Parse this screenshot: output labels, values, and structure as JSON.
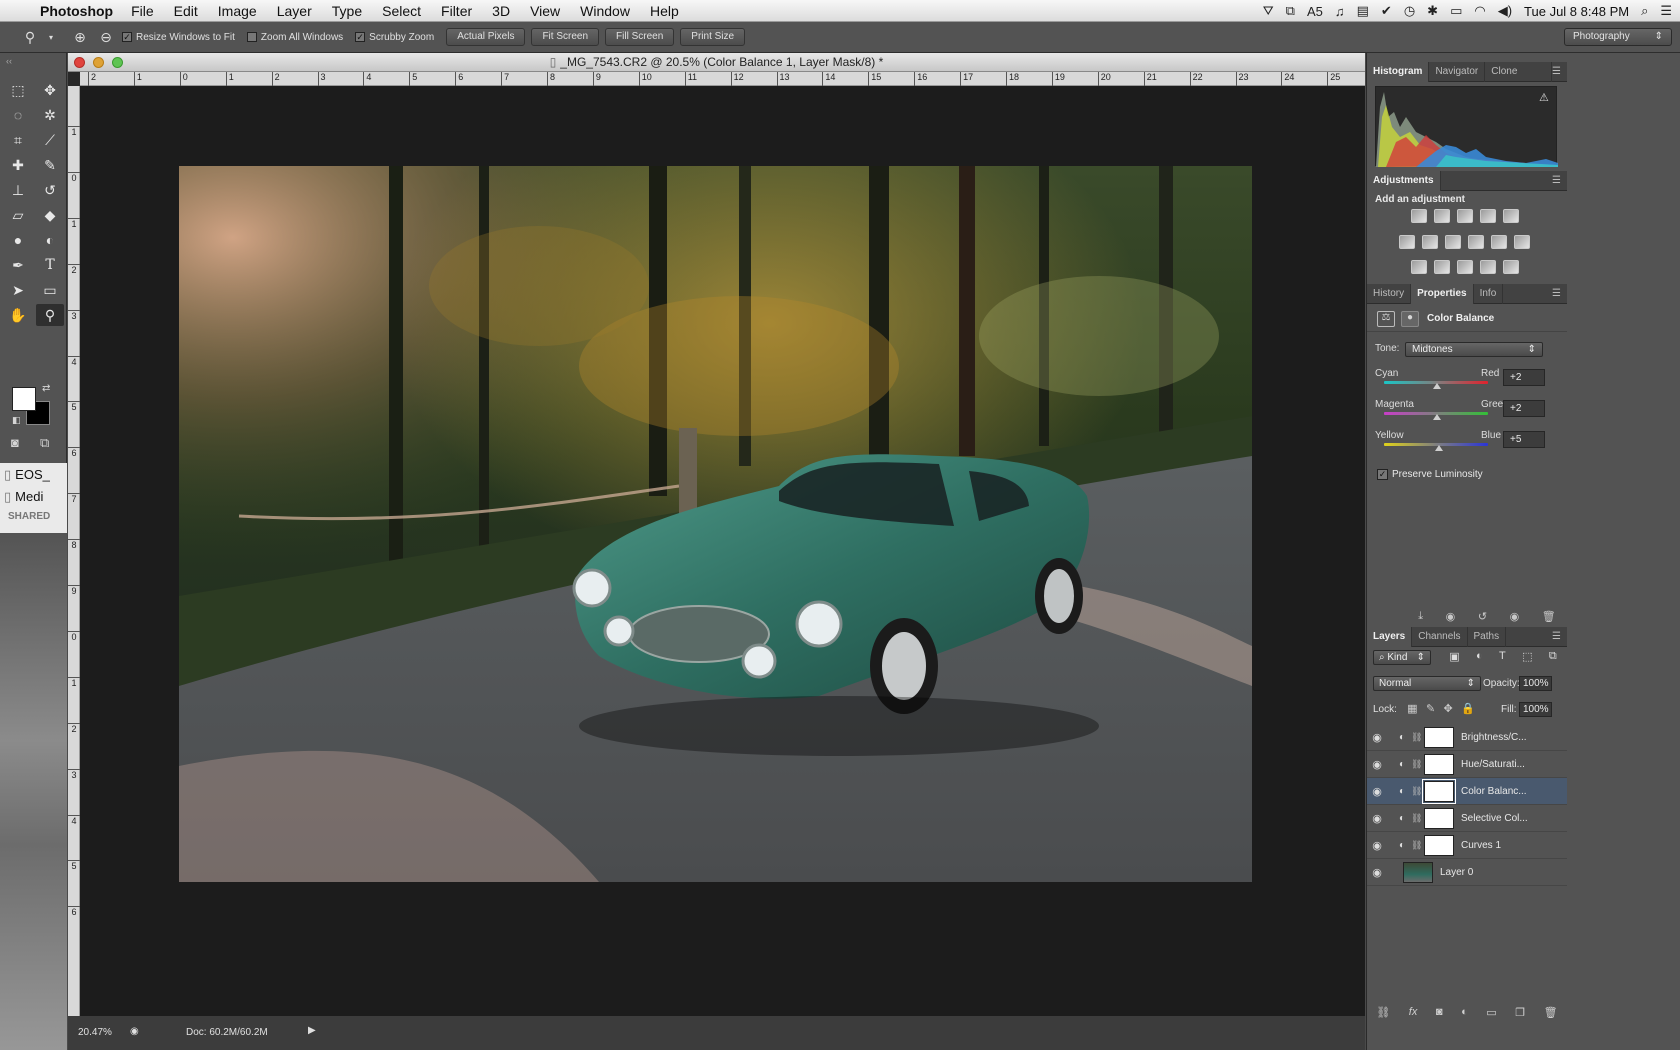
{
  "menubar": {
    "app_name": "Photoshop",
    "menus": [
      "File",
      "Edit",
      "Image",
      "Layer",
      "Type",
      "Select",
      "Filter",
      "3D",
      "View",
      "Window",
      "Help"
    ],
    "status_count": "5",
    "clock": "Tue Jul 8  8:48 PM"
  },
  "options": {
    "resize_windows": "Resize Windows to Fit",
    "zoom_all": "Zoom All Windows",
    "scrubby": "Scrubby Zoom",
    "actual_pixels": "Actual Pixels",
    "fit_screen": "Fit Screen",
    "fill_screen": "Fill Screen",
    "print_size": "Print Size",
    "workspace": "Photography"
  },
  "document": {
    "title": "_MG_7543.CR2 @ 20.5% (Color Balance 1, Layer Mask/8) *",
    "ruler_h": [
      "2",
      "1",
      "0",
      "1",
      "2",
      "3",
      "4",
      "5",
      "6",
      "7",
      "8",
      "9",
      "10",
      "11",
      "12",
      "13",
      "14",
      "15",
      "16",
      "17",
      "18",
      "19",
      "20",
      "21",
      "22",
      "23",
      "24",
      "25"
    ],
    "ruler_v": [
      "1",
      "0",
      "1",
      "2",
      "3",
      "4",
      "5",
      "6",
      "7",
      "8",
      "9",
      "0",
      "1",
      "2",
      "3",
      "4",
      "5",
      "6"
    ],
    "zoom": "20.47%",
    "doc_size": "Doc: 60.2M/60.2M"
  },
  "sidebar_files": {
    "item1": "EOS_",
    "item2": "Medi",
    "shared": "SHARED"
  },
  "panels": {
    "top_tabs": [
      "Histogram",
      "Navigator",
      "Clone Sourc"
    ],
    "adjustments_tab": "Adjustments",
    "add_adjustment": "Add an adjustment",
    "prop_tabs": [
      "History",
      "Properties",
      "Info"
    ],
    "prop_title": "Color Balance",
    "tone_label": "Tone:",
    "tone_value": "Midtones",
    "sliders": [
      {
        "left": "Cyan",
        "right": "Red",
        "value": "+2",
        "level": 0.51
      },
      {
        "left": "Magenta",
        "right": "Green",
        "value": "+2",
        "level": 0.51
      },
      {
        "left": "Yellow",
        "right": "Blue",
        "value": "+5",
        "level": 0.525
      }
    ],
    "preserve": "Preserve Luminosity",
    "layer_tabs": [
      "Layers",
      "Channels",
      "Paths"
    ],
    "kind": "Kind",
    "blend": "Normal",
    "opacity_label": "Opacity:",
    "opacity": "100%",
    "lock_label": "Lock:",
    "fill_label": "Fill:",
    "fill": "100%",
    "layers": [
      {
        "name": "Brightness/C...",
        "type": "adj"
      },
      {
        "name": "Hue/Saturati...",
        "type": "adj"
      },
      {
        "name": "Color Balanc...",
        "type": "adj",
        "selected": true
      },
      {
        "name": "Selective Col...",
        "type": "adj"
      },
      {
        "name": "Curves 1",
        "type": "adj"
      },
      {
        "name": "Layer 0",
        "type": "pixel"
      }
    ]
  }
}
